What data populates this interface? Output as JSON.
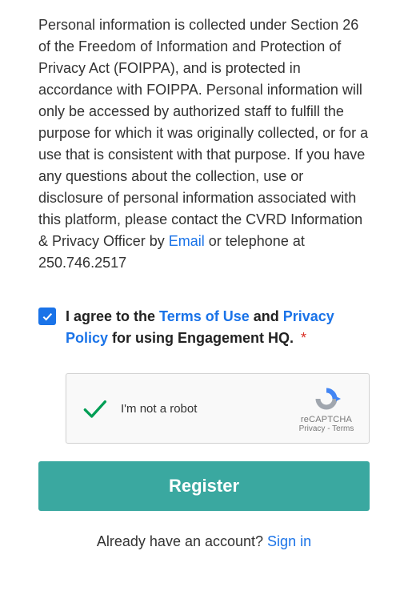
{
  "privacy": {
    "text_before_email": "Personal information is collected under Section 26 of the Freedom of Information and Protection of Privacy Act (FOIPPA), and is protected in accordance with FOIPPA. Personal information will only be accessed by authorized staff to fulfill the purpose for which it was originally collected, or for a use that is consistent with that purpose. If you have any questions about the collection, use or disclosure of personal information associated with this platform, please contact the CVRD Information & Privacy Officer by ",
    "email_link_text": "Email",
    "text_after_email": " or telephone at 250.746.2517"
  },
  "agree": {
    "prefix": "I agree to the ",
    "terms_text": "Terms of Use",
    "middle": " and ",
    "privacy_text": "Privacy Policy",
    "suffix": " for using Engagement HQ. ",
    "required_mark": "*",
    "checked": true
  },
  "recaptcha": {
    "label": "I'm not a robot",
    "brand": "reCAPTCHA",
    "privacy": "Privacy",
    "separator": " - ",
    "terms": "Terms"
  },
  "register_button": "Register",
  "already": {
    "text": "Already have an account? ",
    "signin": "Sign in"
  }
}
